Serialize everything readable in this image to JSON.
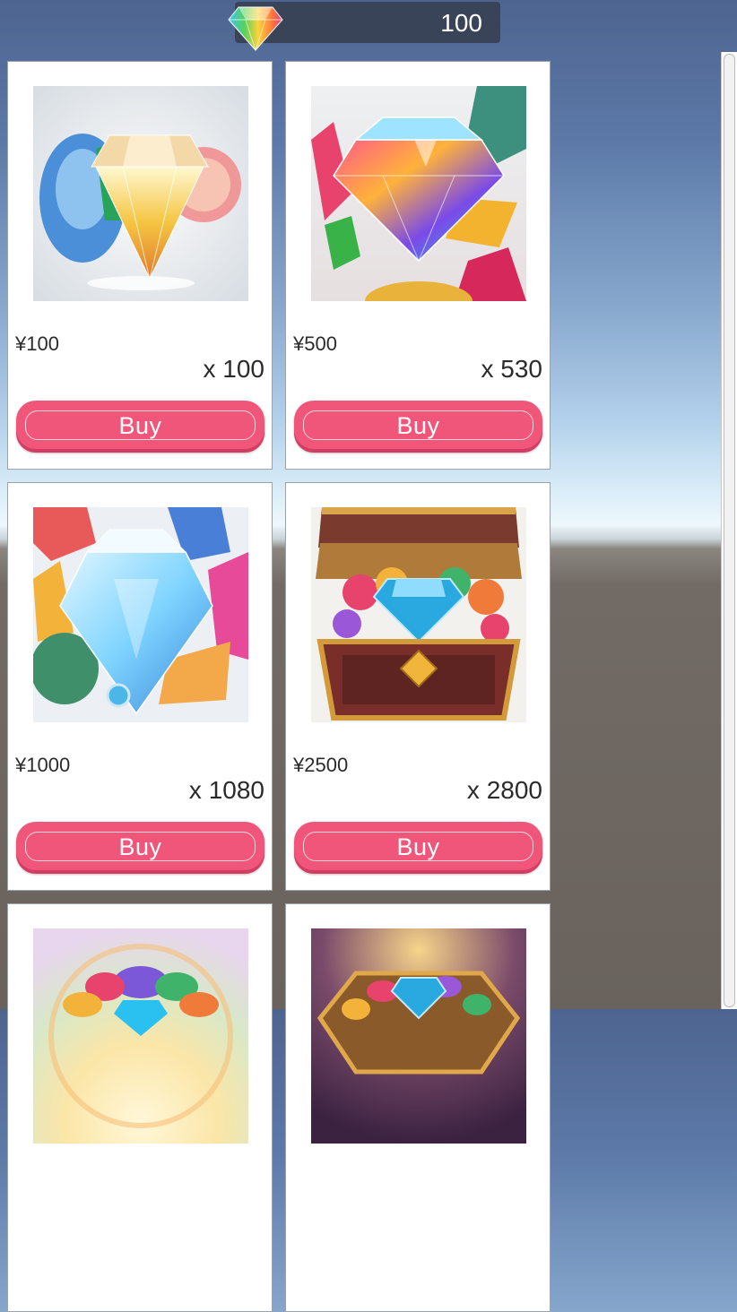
{
  "currency": {
    "amount": "100",
    "icon": "rainbow-gem-icon"
  },
  "products": [
    {
      "price": "¥100",
      "amount": "x 100",
      "button": "Buy",
      "image": "gem-cluster-image"
    },
    {
      "price": "¥500",
      "amount": "x 530",
      "button": "Buy",
      "image": "gem-burst-image"
    },
    {
      "price": "¥1000",
      "amount": "x 1080",
      "button": "Buy",
      "image": "crystal-pile-image"
    },
    {
      "price": "¥2500",
      "amount": "x 2800",
      "button": "Buy",
      "image": "treasure-chest-image"
    },
    {
      "image": "gem-rainbow-mound-image"
    },
    {
      "image": "gem-octagon-box-image"
    }
  ],
  "colors": {
    "buy_button": "#f0567a",
    "currency_bar": "#3a4458",
    "card_bg": "#ffffff"
  }
}
